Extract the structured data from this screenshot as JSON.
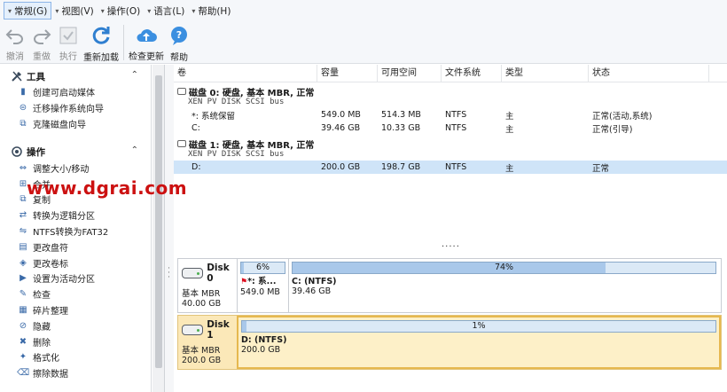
{
  "menu": [
    {
      "label": "常规(G)",
      "active": true
    },
    {
      "label": "视图(V)"
    },
    {
      "label": "操作(O)"
    },
    {
      "label": "语言(L)"
    },
    {
      "label": "帮助(H)"
    }
  ],
  "toolbar": {
    "undo": "撤消",
    "redo": "重做",
    "apply": "执行",
    "reload": "重新加载",
    "check_update": "检查更新",
    "help": "帮助"
  },
  "sidebar": {
    "tools_title": "工具",
    "tools": [
      "创建可启动媒体",
      "迁移操作系统向导",
      "克隆磁盘向导"
    ],
    "ops_title": "操作",
    "ops": [
      "调整大小/移动",
      "合并",
      "复制",
      "转换为逻辑分区",
      "NTFS转换为FAT32",
      "更改盘符",
      "更改卷标",
      "设置为活动分区",
      "检查",
      "碎片整理",
      "隐藏",
      "删除",
      "格式化",
      "擦除数据"
    ]
  },
  "table": {
    "headers": [
      "卷",
      "容量",
      "可用空间",
      "文件系统",
      "类型",
      "状态"
    ],
    "groups": [
      {
        "title": "磁盘 0: 硬盘, 基本 MBR, 正常",
        "sub": "XEN PV DISK SCSI bus",
        "rows": [
          {
            "vol": "*: 系统保留",
            "cap": "549.0 MB",
            "free": "514.3 MB",
            "fs": "NTFS",
            "type": "主",
            "status": "正常(活动,系统)"
          },
          {
            "vol": "C:",
            "cap": "39.46 GB",
            "free": "10.33 GB",
            "fs": "NTFS",
            "type": "主",
            "status": "正常(引导)"
          }
        ]
      },
      {
        "title": "磁盘 1: 硬盘, 基本 MBR, 正常",
        "sub": "XEN PV DISK SCSI bus",
        "rows": [
          {
            "vol": "D:",
            "cap": "200.0 GB",
            "free": "198.7 GB",
            "fs": "NTFS",
            "type": "主",
            "status": "正常",
            "selected": true
          }
        ]
      }
    ],
    "more": "....."
  },
  "diskmap": {
    "disk0": {
      "name": "Disk 0",
      "kind": "基本 MBR",
      "size": "40.00 GB",
      "p1": {
        "pct_label": "6%",
        "used": 0.06,
        "name": "*: 系...",
        "size": "549.0 MB"
      },
      "p2": {
        "pct_label": "74%",
        "used": 0.74,
        "name": "C: (NTFS)",
        "size": "39.46 GB"
      }
    },
    "disk1": {
      "name": "Disk 1",
      "kind": "基本 MBR",
      "size": "200.0 GB",
      "p1": {
        "pct_label": "1%",
        "used": 0.01,
        "name": "D: (NTFS)",
        "size": "200.0 GB"
      }
    }
  },
  "watermark": "www.dgrai.com"
}
